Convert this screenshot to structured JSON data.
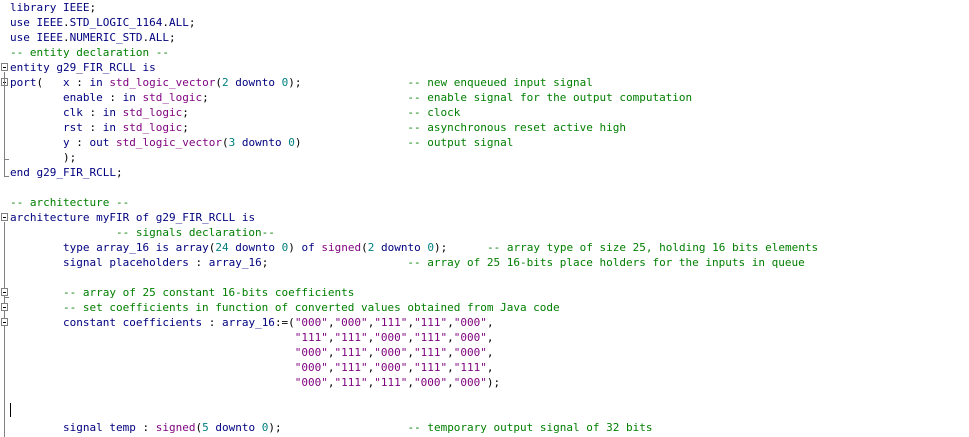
{
  "editor": {
    "language": "VHDL",
    "lines": [
      "library IEEE;",
      "use IEEE.STD_LOGIC_1164.ALL;",
      "use IEEE.NUMERIC_STD.ALL;",
      "-- entity declaration --",
      "entity g29_FIR_RCLL is",
      "port(   x : in std_logic_vector(2 downto 0);                -- new enqueued input signal",
      "        enable : in std_logic;                              -- enable signal for the output computation",
      "        clk : in std_logic;                                 -- clock",
      "        rst : in std_logic;                                 -- asynchronous reset active high",
      "        y : out std_logic_vector(3 downto 0)                -- output signal",
      "        );",
      "end g29_FIR_RCLL;",
      "",
      "-- architecture --",
      "architecture myFIR of g29_FIR_RCLL is",
      "                -- signals declaration--",
      "        type array_16 is array(24 downto 0) of signed(2 downto 0);      -- array type of size 25, holding 16 bits elements",
      "        signal placeholders : array_16;                     -- array of 25 16-bits place holders for the inputs in queue",
      "",
      "        -- array of 25 constant 16-bits coefficients",
      "        -- set coefficients in function of converted values obtained from Java code",
      "        constant coefficients : array_16:=(\"000\",\"000\",\"111\",\"111\",\"000\",",
      "                                           \"111\",\"111\",\"000\",\"111\",\"000\",",
      "                                           \"000\",\"111\",\"000\",\"111\",\"000\",",
      "                                           \"000\",\"111\",\"000\",\"111\",\"111\",",
      "                                           \"000\",\"111\",\"111\",\"000\",\"000\");",
      "",
      "",
      "        signal temp : signed(5 downto 0);                   -- temporary output signal of 32 bits"
    ]
  }
}
